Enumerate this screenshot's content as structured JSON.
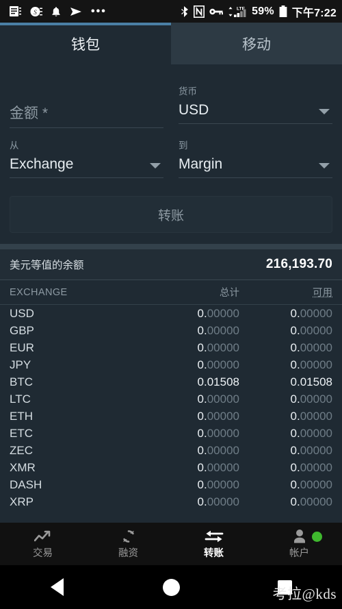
{
  "status_bar": {
    "icons": [
      "note-icon",
      "s-badge-icon",
      "bell-icon",
      "telegram-send-icon",
      "more-dots-icon",
      "bluetooth-icon",
      "nfc-icon",
      "vpn-key-icon",
      "lte-signal-icon"
    ],
    "battery_percent": "59%",
    "time": "下午7:22"
  },
  "tabs": [
    {
      "label": "钱包",
      "active": true
    },
    {
      "label": "移动",
      "active": false
    }
  ],
  "form": {
    "amount": {
      "label": "",
      "placeholder": "金额 *",
      "value": ""
    },
    "currency": {
      "label": "货币",
      "value": "USD"
    },
    "from": {
      "label": "从",
      "value": "Exchange"
    },
    "to": {
      "label": "到",
      "value": "Margin"
    },
    "submit_label": "转账"
  },
  "balance": {
    "label": "美元等值的余额",
    "value": "216,193.70"
  },
  "table": {
    "headers": {
      "name": "EXCHANGE",
      "total": "总计",
      "available": "可用"
    },
    "rows": [
      {
        "name": "USD",
        "total": "0.00000",
        "available": "0.00000",
        "highlight": false
      },
      {
        "name": "GBP",
        "total": "0.00000",
        "available": "0.00000",
        "highlight": false
      },
      {
        "name": "EUR",
        "total": "0.00000",
        "available": "0.00000",
        "highlight": false
      },
      {
        "name": "JPY",
        "total": "0.00000",
        "available": "0.00000",
        "highlight": false
      },
      {
        "name": "BTC",
        "total": "0.01508",
        "available": "0.01508",
        "highlight": true
      },
      {
        "name": "LTC",
        "total": "0.00000",
        "available": "0.00000",
        "highlight": false
      },
      {
        "name": "ETH",
        "total": "0.00000",
        "available": "0.00000",
        "highlight": false
      },
      {
        "name": "ETC",
        "total": "0.00000",
        "available": "0.00000",
        "highlight": false
      },
      {
        "name": "ZEC",
        "total": "0.00000",
        "available": "0.00000",
        "highlight": false
      },
      {
        "name": "XMR",
        "total": "0.00000",
        "available": "0.00000",
        "highlight": false
      },
      {
        "name": "DASH",
        "total": "0.00000",
        "available": "0.00000",
        "highlight": false
      },
      {
        "name": "XRP",
        "total": "0.00000",
        "available": "0.00000",
        "highlight": false
      }
    ]
  },
  "bottom_nav": [
    {
      "label": "交易",
      "icon": "trending-up-icon",
      "active": false
    },
    {
      "label": "融资",
      "icon": "refresh-icon",
      "active": false
    },
    {
      "label": "转账",
      "icon": "transfer-arrows-icon",
      "active": true
    },
    {
      "label": "帐户",
      "icon": "person-icon",
      "active": false,
      "status_dot": true
    }
  ],
  "android_nav": {
    "back": "back-triangle",
    "home": "home-circle",
    "recents": "recents-square",
    "watermark": "考拉@kds"
  },
  "colors": {
    "app_bg": "#1f2a33",
    "tab_inactive_bg": "#2d3a44",
    "accent_underline": "#4a7fa5",
    "status_dot_green": "#3fb82e"
  }
}
